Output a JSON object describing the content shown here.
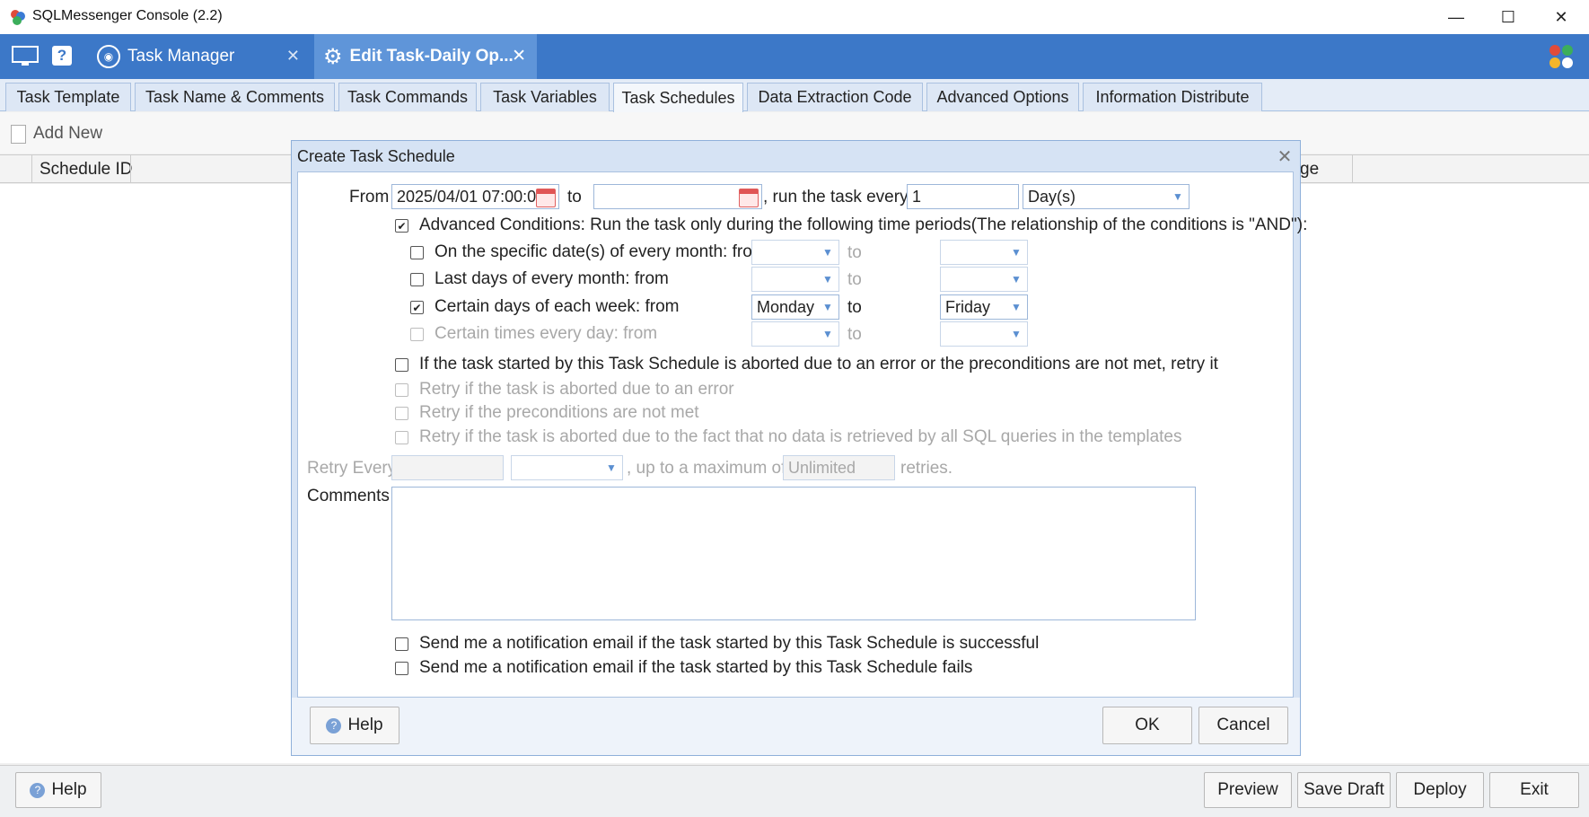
{
  "window": {
    "title": "SQLMessenger Console (2.2)",
    "minimize": "—",
    "maximize": "☐",
    "close": "✕"
  },
  "app_tabs": [
    {
      "label": "Task Manager",
      "close": "✕"
    },
    {
      "label": "Edit Task-Daily Op...",
      "close": "✕"
    }
  ],
  "sub_tabs": [
    "Task Template",
    "Task Name & Comments",
    "Task Commands",
    "Task Variables",
    "Task Schedules",
    "Data Extraction Code",
    "Advanced Options",
    "Information Distribute"
  ],
  "toolbar": {
    "add_new": "Add New"
  },
  "grid": {
    "col_schedule_id": "Schedule ID",
    "col_partial": "ge"
  },
  "dialog": {
    "title": "Create Task Schedule",
    "from_label": "From",
    "from_value": "2025/04/01 07:00:0",
    "to_label": "to",
    "to_value": "",
    "run_every_label": ", run the task every",
    "run_every_value": "1",
    "unit_value": "Day(s)",
    "advanced_conditions": "Advanced Conditions: Run the task only during the following time periods(The relationship of the conditions is \"AND\"):",
    "conditions": [
      {
        "label": "On the specific date(s) of every month: from",
        "checked": false,
        "from": "",
        "to_label": "to",
        "to": ""
      },
      {
        "label": "Last days of every month: from",
        "checked": false,
        "from": "",
        "to_label": "to",
        "to": ""
      },
      {
        "label": "Certain days of each week: from",
        "checked": true,
        "from": "Monday",
        "to_label": "to",
        "to": "Friday"
      },
      {
        "label": "Certain times every day: from",
        "checked": false,
        "from": "",
        "to_label": "to",
        "to": ""
      }
    ],
    "retry_main": "If the task started by this Task Schedule is aborted due to an error or the preconditions are not met, retry it",
    "retry_options": [
      "Retry if the task is aborted due to an error",
      "Retry if the preconditions are not met",
      "Retry if the task is aborted due to the fact that no data is retrieved by all SQL queries in the templates"
    ],
    "retry_every_label": "Retry Every",
    "retry_max_label": ", up to a maximum of",
    "retry_max_value": "Unlimited",
    "retries_label": "retries.",
    "comments_label": "Comments",
    "notify_success": "Send me a notification email if the task started by this Task Schedule is successful",
    "notify_fail": "Send me a notification email if the task started by this Task Schedule fails",
    "help": "Help",
    "ok": "OK",
    "cancel": "Cancel"
  },
  "bottom": {
    "help": "Help",
    "preview": "Preview",
    "save_draft": "Save Draft",
    "deploy": "Deploy",
    "exit": "Exit"
  },
  "colors": {
    "accent": "#3c78c8",
    "active_tab": "#5f95d9",
    "dialog_frame": "#d6e3f4"
  }
}
